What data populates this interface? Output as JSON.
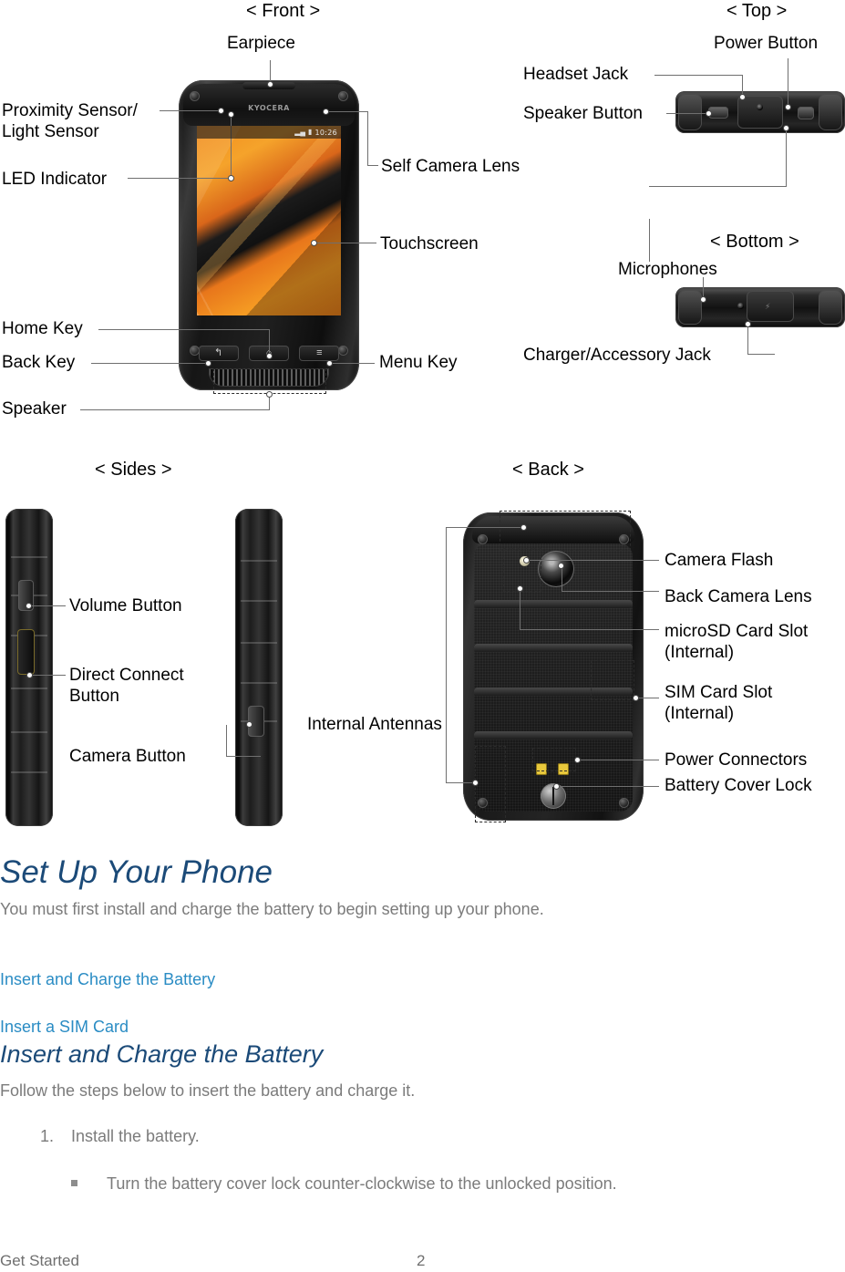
{
  "page": {
    "footer_left": "Get Started",
    "page_number": "2"
  },
  "diagrams": {
    "front": {
      "title": "< Front >",
      "labels": {
        "earpiece": "Earpiece",
        "proximity": "Proximity Sensor/\nLight Sensor",
        "led": "LED Indicator",
        "self_camera": "Self Camera Lens",
        "touchscreen": "Touchscreen",
        "home_key": "Home Key",
        "back_key": "Back Key",
        "speaker": "Speaker",
        "menu_key": "Menu Key"
      },
      "screen": {
        "brand": "KYOCERA",
        "status_time": "10:26",
        "status_signal_icon": "signal-bars-icon",
        "status_battery_icon": "battery-icon",
        "nav_back_icon": "back-arrow-icon",
        "nav_home_icon": "home-icon",
        "nav_menu_icon": "menu-lines-icon"
      }
    },
    "top": {
      "title": "< Top >",
      "labels": {
        "power_button": "Power Button",
        "headset_jack": "Headset Jack",
        "speaker_button": "Speaker Button"
      }
    },
    "bottom": {
      "title": "< Bottom >",
      "labels": {
        "microphones": "Microphones",
        "charger_jack": "Charger/Accessory Jack"
      }
    },
    "sides": {
      "title": "< Sides >",
      "labels": {
        "volume_button": "Volume Button",
        "direct_connect": "Direct Connect\nButton",
        "camera_button": "Camera Button"
      }
    },
    "back": {
      "title": "< Back >",
      "labels": {
        "camera_flash": "Camera Flash",
        "back_camera_lens": "Back Camera Lens",
        "microsd": "microSD Card Slot\n(Internal)",
        "sim": "SIM Card Slot\n(Internal)",
        "power_connectors": "Power Connectors",
        "battery_cover_lock": "Battery Cover Lock",
        "internal_antennas": "Internal Antennas"
      }
    }
  },
  "content": {
    "h1": "Set Up Your Phone",
    "intro": "You must first install and charge the battery to begin setting up your phone.",
    "toc": [
      "Insert and Charge the Battery",
      "Insert a SIM Card"
    ],
    "h2": "Insert and Charge the Battery",
    "h2_intro": "Follow the steps below to insert the battery and charge it.",
    "step_number": "1.",
    "step_text": "Install the battery.",
    "substep_text": "Turn the battery cover lock counter-clockwise to the unlocked position."
  },
  "colors": {
    "heading": "#1b4a78",
    "link": "#2a8cc4",
    "body_text": "#7b7b7b",
    "label_text": "#000000",
    "leader_line": "#6f6f6f"
  }
}
